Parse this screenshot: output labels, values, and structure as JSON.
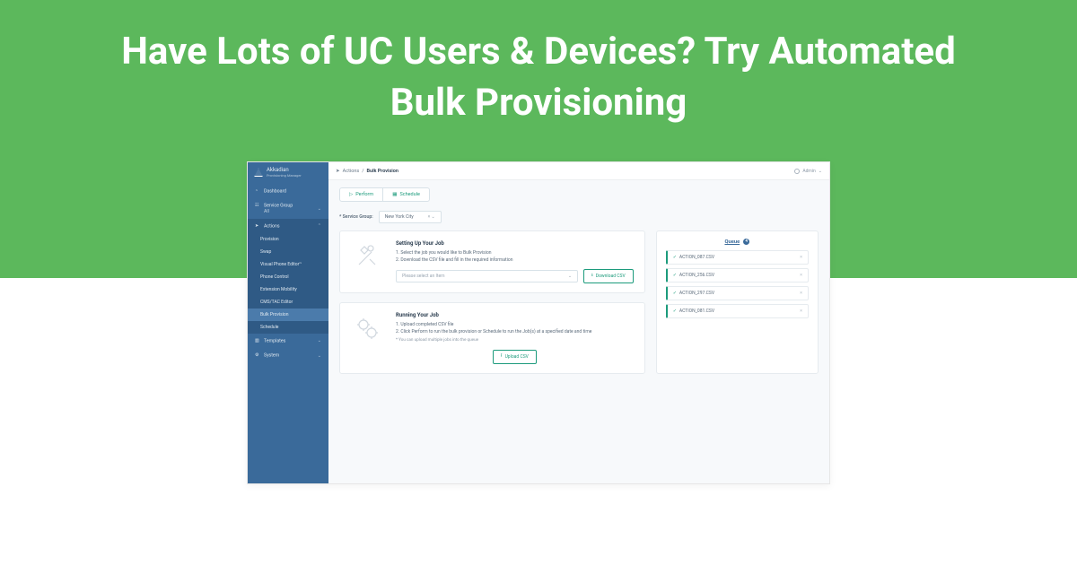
{
  "hero": {
    "headline": "Have Lots of UC Users & Devices? Try Automated Bulk Provisioning"
  },
  "brand": {
    "name": "Akkadian",
    "subtitle": "Provisioning Manager"
  },
  "sidebar": {
    "dashboard": "Dashboard",
    "service_group_label": "Service Group",
    "service_group_value": "All",
    "actions": "Actions",
    "action_items": [
      "Provision",
      "Swap",
      "Visual Phone Editor™",
      "Phone Control",
      "Extension Mobility",
      "CMS/TAC Editor",
      "Bulk Provision",
      "Schedule"
    ],
    "templates": "Templates",
    "system": "System"
  },
  "breadcrumb": {
    "section": "Actions",
    "page": "Bulk Provision"
  },
  "user_menu": "Admin",
  "toolbar": {
    "perform": "Perform",
    "schedule": "Schedule"
  },
  "filter": {
    "label": "* Service Group:",
    "value": "New York City"
  },
  "setup": {
    "title": "Setting Up Your Job",
    "step1": "1. Select the job you would like to Bulk Provision",
    "step2": "2. Download the CSV file and fill in the required information",
    "select_placeholder": "Please select an Item",
    "download_btn": "Download CSV"
  },
  "run": {
    "title": "Running Your Job",
    "step1": "1. Upload completed CSV file",
    "step2": "2. Click Perform to run the bulk provision or Schedule to run the Job(s) at a specified date and time",
    "note": "* You can upload multiple jobs into the queue",
    "upload_btn": "Upload CSV"
  },
  "queue": {
    "title": "Queue",
    "count": "4",
    "items": [
      "ACTION_087.CSV",
      "ACTION_256.CSV",
      "ACTION_297.CSV",
      "ACTION_081.CSV"
    ]
  }
}
